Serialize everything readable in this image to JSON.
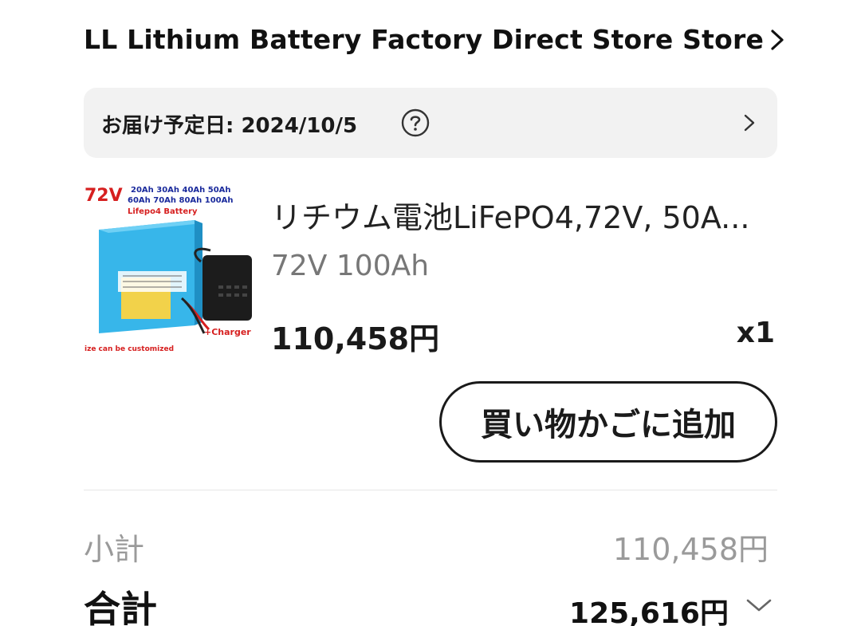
{
  "store": {
    "name": "LL Lithium Battery Factory Direct Store Store"
  },
  "delivery": {
    "label": "お届け予定日: 2024/10/5"
  },
  "product": {
    "title": "リチウム電池LiFePO4,72V, 50A...",
    "variant": "72V 100Ah",
    "price": "110,458円",
    "quantity": "x1",
    "image": {
      "voltage": "72V",
      "capacities_line1": "20Ah 30Ah 40Ah 50Ah",
      "capacities_line2": "60Ah 70Ah 80Ah 100Ah",
      "chemistry": "Lifepo4 Battery",
      "charger": "+Charger",
      "note": "ize can be customized"
    }
  },
  "actions": {
    "add_to_cart_label": "買い物かごに追加"
  },
  "summary": {
    "subtotal_label": "小計",
    "subtotal_value": "110,458円",
    "total_label": "合計",
    "total_value": "125,616円"
  },
  "icons": {
    "store_chevron": "chevron-right-icon",
    "help": "question-circle-icon",
    "delivery_chevron": "chevron-right-icon",
    "total_chevron": "chevron-down-icon"
  }
}
